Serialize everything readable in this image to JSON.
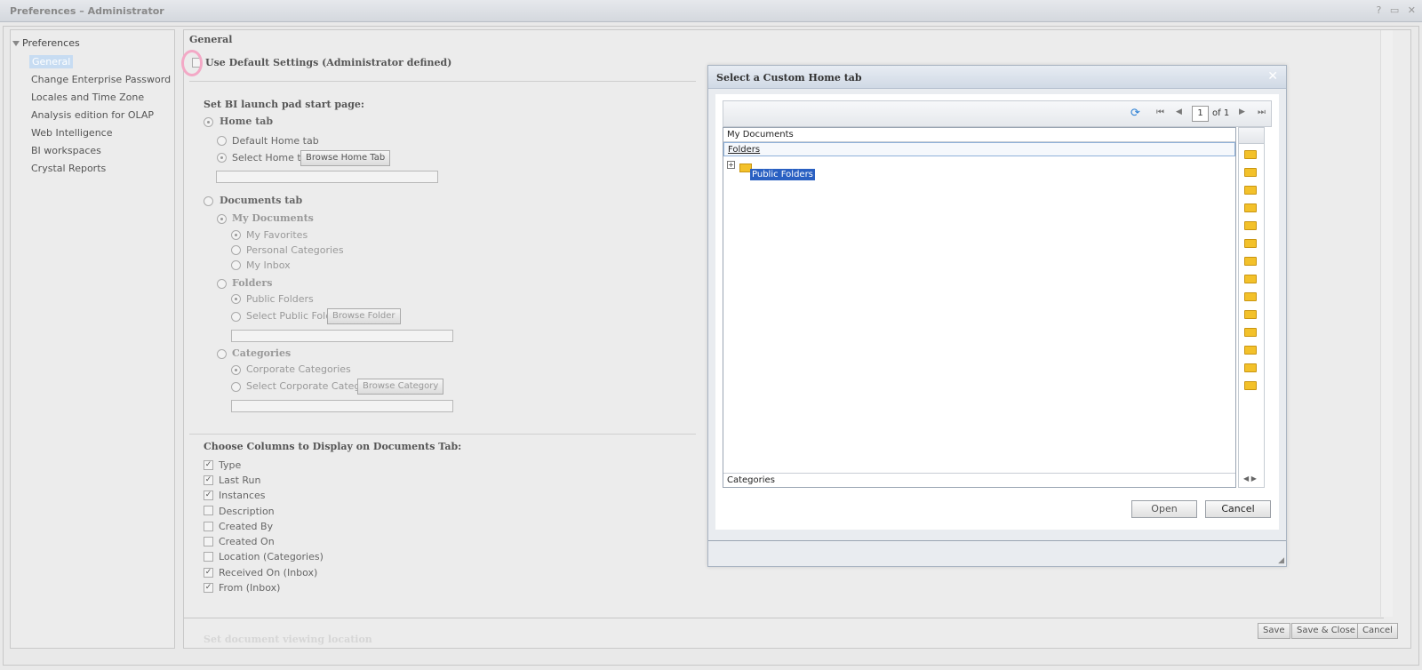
{
  "window": {
    "title": "Preferences – Administrator",
    "controls": "? ▭ ✕"
  },
  "tree": {
    "root": "Preferences",
    "items": [
      "General",
      "Change Enterprise Password",
      "Locales and Time Zone",
      "Analysis edition for OLAP",
      "Web Intelligence",
      "BI workspaces",
      "Crystal Reports"
    ],
    "selected_index": 0
  },
  "general": {
    "heading": "General",
    "use_default": "Use Default Settings (Administrator defined)",
    "start_page_heading": "Set BI launch pad start page:",
    "home_tab": "Home tab",
    "default_home_tab": "Default Home tab",
    "select_home_tab": "Select Home tab:",
    "browse_home_tab": "Browse Home Tab",
    "documents_tab": "Documents tab",
    "my_documents": "My Documents",
    "my_favorites": "My Favorites",
    "personal_categories": "Personal Categories",
    "my_inbox": "My Inbox",
    "folders": "Folders",
    "public_folders": "Public Folders",
    "select_public_folder": "Select Public Folder:",
    "browse_folder": "Browse Folder",
    "categories": "Categories",
    "corporate_categories": "Corporate Categories",
    "select_corporate_category": "Select Corporate Category:",
    "browse_category": "Browse Category",
    "columns_heading": "Choose Columns to Display on Documents Tab:",
    "columns": [
      {
        "label": "Type",
        "checked": true
      },
      {
        "label": "Last Run",
        "checked": true
      },
      {
        "label": "Instances",
        "checked": true
      },
      {
        "label": "Description",
        "checked": false
      },
      {
        "label": "Created By",
        "checked": false
      },
      {
        "label": "Created On",
        "checked": false
      },
      {
        "label": "Location (Categories)",
        "checked": false
      },
      {
        "label": "Received On (Inbox)",
        "checked": true
      },
      {
        "label": "From (Inbox)",
        "checked": true
      }
    ],
    "viewing_location": "Set document viewing location"
  },
  "footer": {
    "save": "Save",
    "save_close": "Save & Close",
    "cancel": "Cancel"
  },
  "dialog": {
    "title": "Select a Custom Home tab",
    "page_input": "1",
    "page_of": "of 1",
    "sections": {
      "my_documents": "My Documents",
      "folders": "Folders",
      "categories": "Categories"
    },
    "tree_node": "Public Folders",
    "open": "Open",
    "cancel": "Cancel"
  },
  "colors": {
    "selection": "#2a60c2",
    "tree_selected": "#c7dcf2",
    "folder": "#f3c12a"
  }
}
